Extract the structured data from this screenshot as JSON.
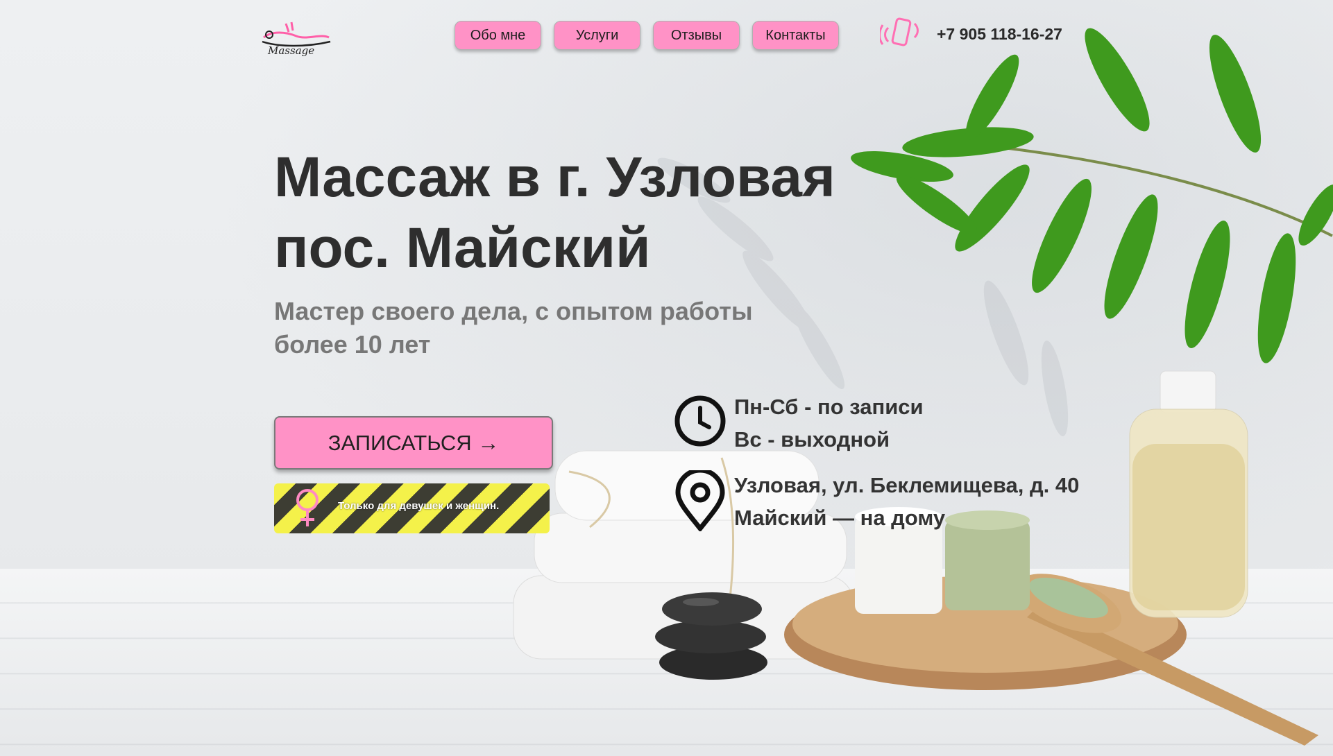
{
  "brand": {
    "logo_text": "Massage"
  },
  "nav": {
    "items": [
      {
        "label": "Обо мне"
      },
      {
        "label": "Услуги"
      },
      {
        "label": "Отзывы"
      },
      {
        "label": "Контакты"
      }
    ]
  },
  "header": {
    "phone": "+7 905 118-16-27",
    "phone_icon": "phone-vibrate-icon"
  },
  "hero": {
    "title_line1": "Массаж в г. Узловая",
    "title_line2": "пос. Майский",
    "subtitle_line1": "Мастер своего дела, с опытом работы",
    "subtitle_line2": "более 10 лет",
    "cta_label": "ЗАПИСАТЬСЯ →",
    "notice": "Только для девушек и женщин."
  },
  "info": {
    "schedule_line1": "Пн-Сб - по записи",
    "schedule_line2": "Вс - выходной",
    "address_line1": "Узловая, ул. Беклемищева, д. 40",
    "address_line2": "Майский — на дому"
  },
  "colors": {
    "accent": "#ff92c6",
    "text_dark": "#2e2e2e",
    "text_muted": "#777777",
    "warning_yellow": "#f4f14a"
  }
}
